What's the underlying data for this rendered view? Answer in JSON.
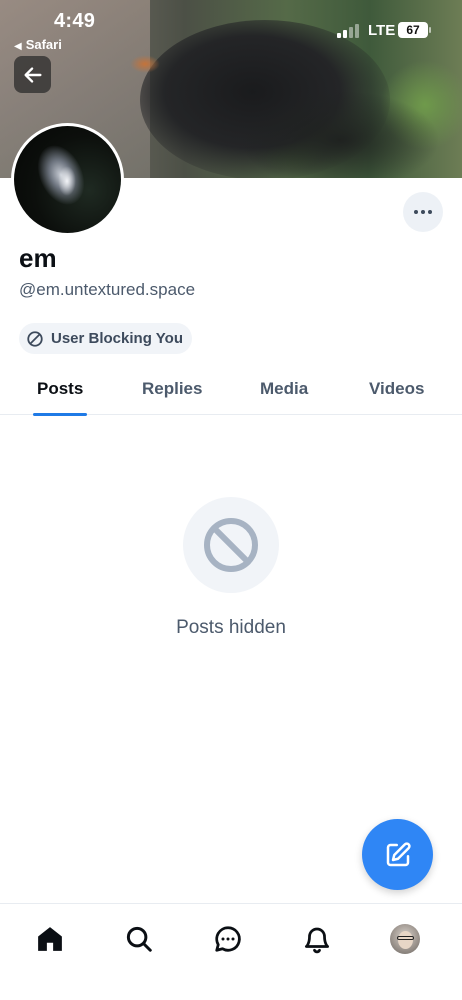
{
  "status_bar": {
    "time": "4:49",
    "back_app": "Safari",
    "network": "LTE",
    "battery": "67"
  },
  "profile": {
    "display_name": "em",
    "handle": "@em.untextured.space",
    "badge_label": "User Blocking You"
  },
  "tabs": [
    {
      "label": "Posts",
      "active": true
    },
    {
      "label": "Replies",
      "active": false
    },
    {
      "label": "Media",
      "active": false
    },
    {
      "label": "Videos",
      "active": false
    }
  ],
  "empty_state": {
    "message": "Posts hidden",
    "icon": "ban-icon"
  },
  "nav": {
    "items": [
      "home-icon",
      "search-icon",
      "chat-icon",
      "bell-icon",
      "profile-avatar"
    ]
  },
  "colors": {
    "accent": "#1f7ae6",
    "fab": "#2f86f5",
    "muted_text": "#4c5a6c"
  }
}
